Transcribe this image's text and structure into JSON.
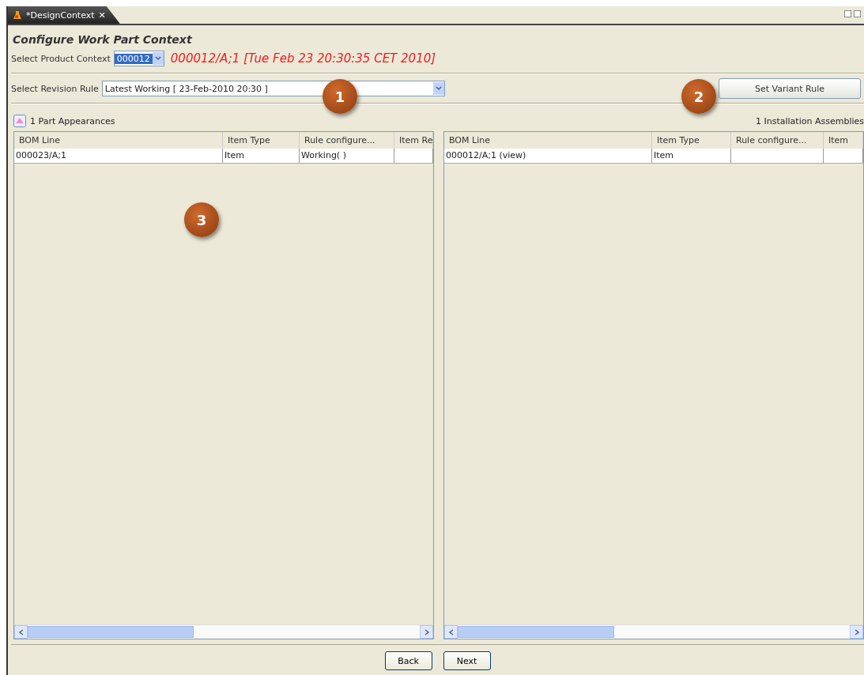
{
  "tab": {
    "title": "*DesignContext",
    "close": "✕"
  },
  "form_title": "Configure Work Part Context",
  "product_context": {
    "label": "Select Product Context",
    "value": "000012",
    "info": "000012/A;1 [Tue Feb 23 20:30:35 CET 2010]"
  },
  "revision_rule": {
    "label": "Select Revision Rule",
    "value": "Latest Working [ 23-Feb-2010 20:30 ]"
  },
  "variant_button": "Set Variant Rule",
  "left_panel": {
    "caption": "1 Part Appearances",
    "columns": [
      "BOM Line",
      "Item Type",
      "Rule configure...",
      "Item Re"
    ],
    "rows": [
      [
        "000023/A;1",
        "Item",
        "Working( )",
        ""
      ]
    ]
  },
  "right_panel": {
    "caption": "1 Installation Assemblies",
    "columns": [
      "BOM Line",
      "Item Type",
      "Rule configure...",
      "Item"
    ],
    "rows": [
      [
        "000012/A;1 (view)",
        "Item",
        "",
        ""
      ]
    ]
  },
  "buttons": [
    "Back",
    "Next"
  ],
  "callouts": [
    {
      "text": "1"
    },
    {
      "text": "2"
    },
    {
      "text": "3"
    }
  ]
}
